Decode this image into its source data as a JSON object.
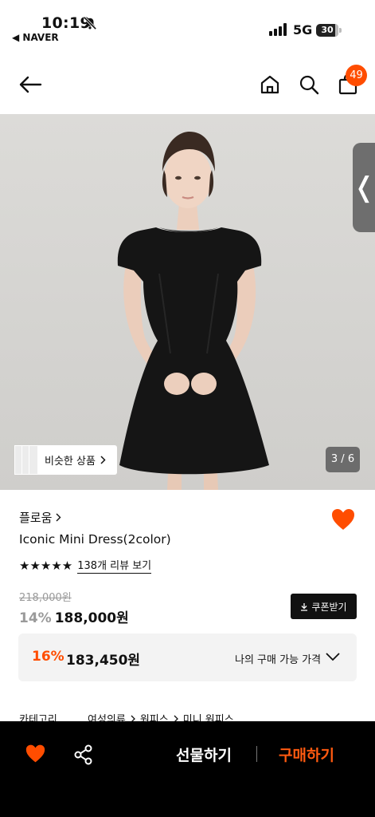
{
  "status_bar": {
    "time": "10:19",
    "back_app": "◀ NAVER",
    "network": "5G",
    "battery": "30"
  },
  "header": {
    "cart_count": "49"
  },
  "gallery": {
    "similar_label": "비슷한 상품",
    "counter": "3 / 6",
    "side_tab_glyph": "❬"
  },
  "product": {
    "brand": "플로움",
    "name": "Iconic Mini Dress(2color)",
    "stars": "★★★★★",
    "rating": 5,
    "reviews": "138개 리뷰 보기",
    "original_price": "218,000원",
    "discount": "14%",
    "price": "188,000원",
    "coupon_label": "쿠폰받기",
    "best": {
      "discount": "16%",
      "price": "183,450원",
      "label": "나의 구매 가능 가격"
    },
    "category": {
      "label": "카테고리",
      "path": [
        "여성의류",
        "원피스",
        "미니 원피스"
      ]
    }
  },
  "bottom_bar": {
    "gift_label": "선물하기",
    "buy_label": "구매하기"
  },
  "colors": {
    "accent": "#ff4d00",
    "buy": "#ff5a10",
    "bar": "#000000",
    "badge": "#ff4d00"
  }
}
